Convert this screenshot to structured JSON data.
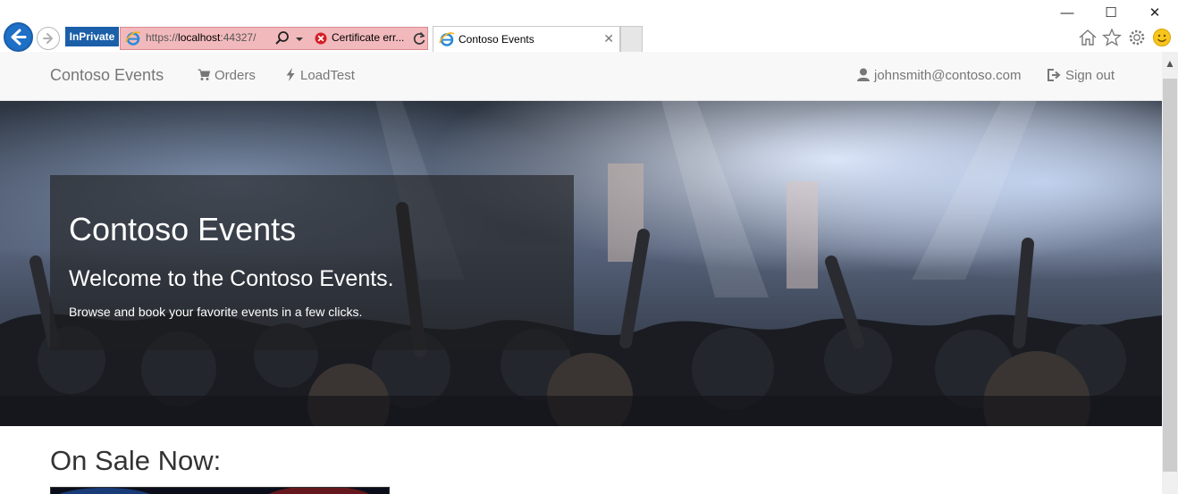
{
  "window": {
    "minimize_glyph": "—",
    "maximize_glyph": "☐",
    "close_glyph": "✕"
  },
  "browser": {
    "inprivate_label": "InPrivate",
    "url_scheme": "https://",
    "url_host": "localhost",
    "url_rest": ":44327/",
    "cert_error_label": "Certificate err...",
    "tab_title": "Contoso Events",
    "tab_close_glyph": "✕",
    "icons": [
      "back-arrow-icon",
      "forward-arrow-icon",
      "ie-logo-icon",
      "search-icon",
      "dropdown-icon",
      "cert-error-icon",
      "refresh-icon",
      "home-icon",
      "favorites-star-icon",
      "settings-gear-icon",
      "feedback-smiley-icon"
    ],
    "accent_color": "#1e6fc6",
    "error_bar_color": "#f2b9bc"
  },
  "navbar": {
    "brand": "Contoso Events",
    "orders_label": "Orders",
    "loadtest_label": "LoadTest",
    "user_label": "johnsmith@contoso.com",
    "signout_label": "Sign out"
  },
  "hero": {
    "title": "Contoso Events",
    "subtitle": "Welcome to the Contoso Events.",
    "text": "Browse and book your favorite events in a few clicks."
  },
  "main": {
    "section_title": "On Sale Now:"
  },
  "scrollbar": {
    "up_glyph": "▲"
  }
}
